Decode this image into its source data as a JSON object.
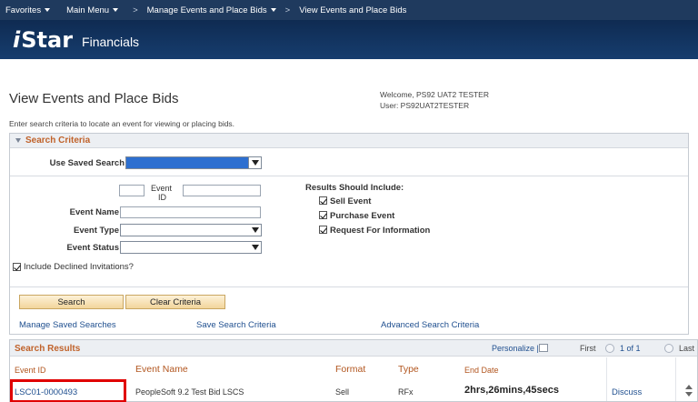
{
  "nav": {
    "favorites": "Favorites",
    "main_menu": "Main Menu",
    "sep1": ">",
    "manage": "Manage Events and Place Bids",
    "sep2": ">",
    "current": "View Events and Place Bids"
  },
  "brand": {
    "logo_i": "i",
    "logo_star": "Star",
    "logo_fin": "Financials"
  },
  "page": {
    "title": "View Events and Place Bids",
    "welcome": "Welcome, PS92 UAT2 TESTER",
    "user": "User: PS92UAT2TESTER",
    "instructions": "Enter search criteria to locate an event for viewing or placing bids."
  },
  "criteria": {
    "header": "Search Criteria",
    "saved_search_label": "Use Saved Search",
    "event_id_label_1": "Event",
    "event_id_label_2": "ID",
    "event_name_label": "Event Name",
    "event_type_label": "Event Type",
    "event_status_label": "Event Status",
    "include_declined": "Include Declined Invitations?",
    "results_include_label": "Results Should Include:",
    "sell_event": "Sell Event",
    "purchase_event": "Purchase Event",
    "rfi": "Request For Information",
    "search_btn": "Search",
    "clear_btn": "Clear Criteria",
    "manage_saved": "Manage Saved Searches",
    "save_criteria": "Save Search Criteria",
    "advanced": "Advanced Search Criteria"
  },
  "results": {
    "title": "Search Results",
    "personalize": "Personalize |",
    "first": "First",
    "of_text": "1 of 1",
    "last": "Last",
    "columns": [
      "Event ID",
      "Event Name",
      "Format",
      "Type",
      "End Date"
    ],
    "row": {
      "event_id": "LSC01-0000493",
      "event_name": "PeopleSoft 9.2 Test Bid LSCS",
      "format": "Sell",
      "type": "RFx",
      "end_date": "2hrs,26mins,45secs",
      "discuss": "Discuss"
    }
  },
  "colors": {
    "nav_bg": "#1f3a5e",
    "brand_bg": "#163d6e",
    "section_header": "#c0622a",
    "link": "#1f4f8f",
    "highlight": "#e00000"
  }
}
